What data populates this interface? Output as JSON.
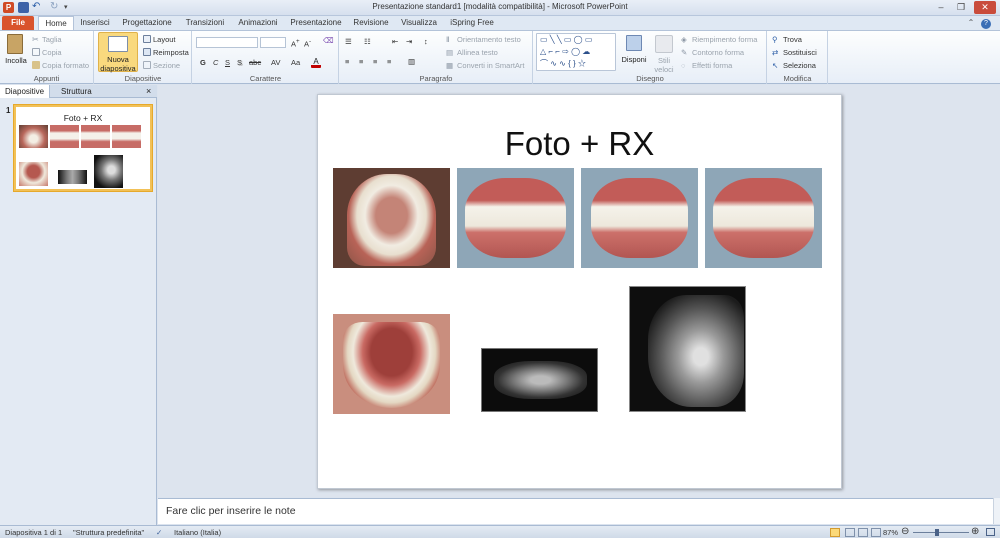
{
  "window": {
    "title": "Presentazione standard1 [modalità compatibilità]  -  Microsoft PowerPoint"
  },
  "tabs": [
    {
      "label": "File"
    },
    {
      "label": "Home"
    },
    {
      "label": "Inserisci"
    },
    {
      "label": "Progettazione"
    },
    {
      "label": "Transizioni"
    },
    {
      "label": "Animazioni"
    },
    {
      "label": "Presentazione"
    },
    {
      "label": "Revisione"
    },
    {
      "label": "Visualizza"
    },
    {
      "label": "iSpring Free"
    }
  ],
  "ribbon": {
    "clipboard": {
      "label": "Appunti",
      "paste": "Incolla",
      "cut": "Taglia",
      "copy": "Copia",
      "format_painter": "Copia formato"
    },
    "slides": {
      "label": "Diapositive",
      "new_slide_1": "Nuova",
      "new_slide_2": "diapositiva",
      "layout": "Layout",
      "reset": "Reimposta",
      "section": "Sezione"
    },
    "font": {
      "label": "Carattere",
      "bold": "G",
      "italic": "C",
      "underline": "S",
      "shadow": "S",
      "strike": "abc"
    },
    "paragraph": {
      "label": "Paragrafo",
      "text_direction": "Orientamento testo",
      "align_text": "Allinea testo",
      "smartart": "Converti in SmartArt"
    },
    "drawing": {
      "label": "Disegno",
      "arrange": "Disponi",
      "quick_styles_1": "Stili",
      "quick_styles_2": "veloci",
      "shape_fill": "Riempimento forma",
      "shape_outline": "Contorno forma",
      "shape_effects": "Effetti forma"
    },
    "editing": {
      "label": "Modifica",
      "find": "Trova",
      "replace": "Sostituisci",
      "select": "Seleziona"
    }
  },
  "left_pane": {
    "tab_slides": "Diapositive",
    "tab_outline": "Struttura",
    "close": "×",
    "slide_number": "1",
    "thumb_title": "Foto + RX"
  },
  "slide": {
    "title": "Foto + RX"
  },
  "notes": {
    "placeholder": "Fare clic per inserire le note"
  },
  "status": {
    "slide_info": "Diapositiva 1 di 1",
    "theme": "\"Struttura predefinita\"",
    "language": "Italiano (Italia)",
    "zoom": "87%"
  },
  "colors": {
    "file_tab": "#d9532c",
    "ribbon_bg": "#e7eef7",
    "selection": "#f2c157"
  }
}
